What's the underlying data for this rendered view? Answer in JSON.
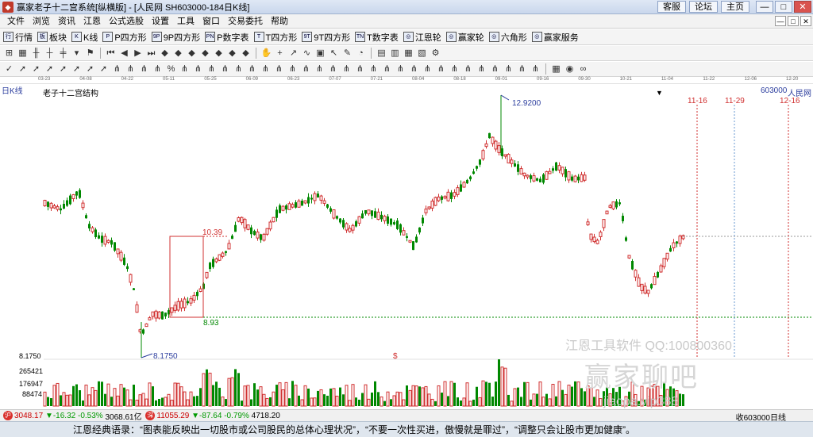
{
  "window": {
    "title": "赢家老子十二宫系统[纵横版] - [人民网  SH603000-184日K线]",
    "links": [
      "客服",
      "论坛",
      "主页"
    ],
    "controls": [
      "—",
      "□",
      "✕"
    ]
  },
  "menu": [
    "文件",
    "浏览",
    "资讯",
    "江恩",
    "公式选股",
    "设置",
    "工具",
    "窗口",
    "交易委托",
    "帮助"
  ],
  "toolbar1": [
    {
      "icon": "行",
      "label": "行情"
    },
    {
      "icon": "板",
      "label": "板块"
    },
    {
      "icon": "K",
      "label": "K线"
    },
    {
      "icon": "P",
      "label": "P四方形"
    },
    {
      "icon": "9P",
      "label": "9P四方形"
    },
    {
      "icon": "PN",
      "label": "P数字表"
    },
    {
      "icon": "T",
      "label": "T四方形"
    },
    {
      "icon": "9T",
      "label": "9T四方形"
    },
    {
      "icon": "TN",
      "label": "T数字表"
    },
    {
      "icon": "◎",
      "label": "江恩轮"
    },
    {
      "icon": "◎",
      "label": "赢家轮"
    },
    {
      "icon": "◎",
      "label": "六角形"
    },
    {
      "icon": "◎",
      "label": "赢家服务"
    }
  ],
  "date_ticks": [
    "03-23",
    "04-08",
    "04-22",
    "05-11",
    "05-25",
    "06-09",
    "06-23",
    "07-07",
    "07-21",
    "08-04",
    "08-18",
    "09-01",
    "09-16",
    "09-30",
    "10-21",
    "11-04",
    "11-22",
    "12-06",
    "12-20"
  ],
  "chart": {
    "period_label": "日K线",
    "structure_label": "老子十二宫结构",
    "code": "603000",
    "name": "人民网",
    "high_label": "12.9200",
    "box_high_label": "10.39",
    "box_low_label": "8.93",
    "low_label": "8.1750",
    "axis_low": "8.1750",
    "dollar_mark": "$",
    "future_dates": [
      "11-16",
      "11-29",
      "12-16"
    ],
    "volume_ticks": [
      "265421",
      "176947",
      "88474"
    ]
  },
  "watermark": {
    "software": "江恩工具软件  QQ:100800360",
    "brand": "赢家聊吧",
    "url": "jiaopa.vip388"
  },
  "status": {
    "index1": "3048.17",
    "index1_change": "▼-16.32",
    "index1_pct": "-0.53%",
    "index1_amount": "3068.61亿",
    "index2": "11055.29",
    "index2_change": "▼-87.64",
    "index2_pct": "-0.79%",
    "index2_amount": "4718.20",
    "right": "收603000日线"
  },
  "quote": "江恩经典语录：“图表能反映出一切股市或公司股民的总体心理状况”，“不要一次性买进，傲慢就是罪过”，“调整只会让股市更加健康”。",
  "colors": {
    "up": "#d03030",
    "down": "#008800",
    "accent": "#2c3e9e"
  }
}
